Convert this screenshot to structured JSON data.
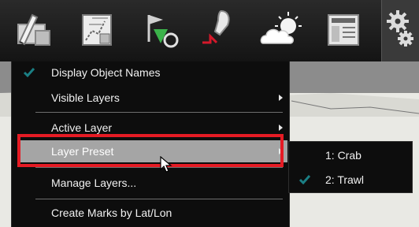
{
  "toolbar": {
    "buttons": [
      {
        "icon": "edit-chart-icon"
      },
      {
        "icon": "route-planning-icon"
      },
      {
        "icon": "waypoint-icon"
      },
      {
        "icon": "boat-track-icon"
      },
      {
        "icon": "weather-icon"
      },
      {
        "icon": "data-panel-icon"
      },
      {
        "icon": "settings-gears-icon"
      }
    ]
  },
  "menu": {
    "items": [
      {
        "label": "Display Object Names",
        "checked": true,
        "submenu": false
      },
      {
        "label": "Visible Layers",
        "checked": false,
        "submenu": true
      },
      {
        "label": "Active Layer",
        "checked": false,
        "submenu": true
      },
      {
        "label": "Layer Preset",
        "checked": false,
        "submenu": true,
        "highlighted": true
      },
      {
        "label": "Manage Layers...",
        "checked": false,
        "submenu": false
      },
      {
        "label": "Create Marks by Lat/Lon",
        "checked": false,
        "submenu": false
      }
    ]
  },
  "submenu": {
    "items": [
      {
        "label": "1: Crab",
        "checked": false
      },
      {
        "label": "2: Trawl",
        "checked": true
      }
    ]
  },
  "colors": {
    "highlight_outline": "#e51b24",
    "check_accent": "#1b7f84",
    "selected_row": "#a5a5a5"
  }
}
